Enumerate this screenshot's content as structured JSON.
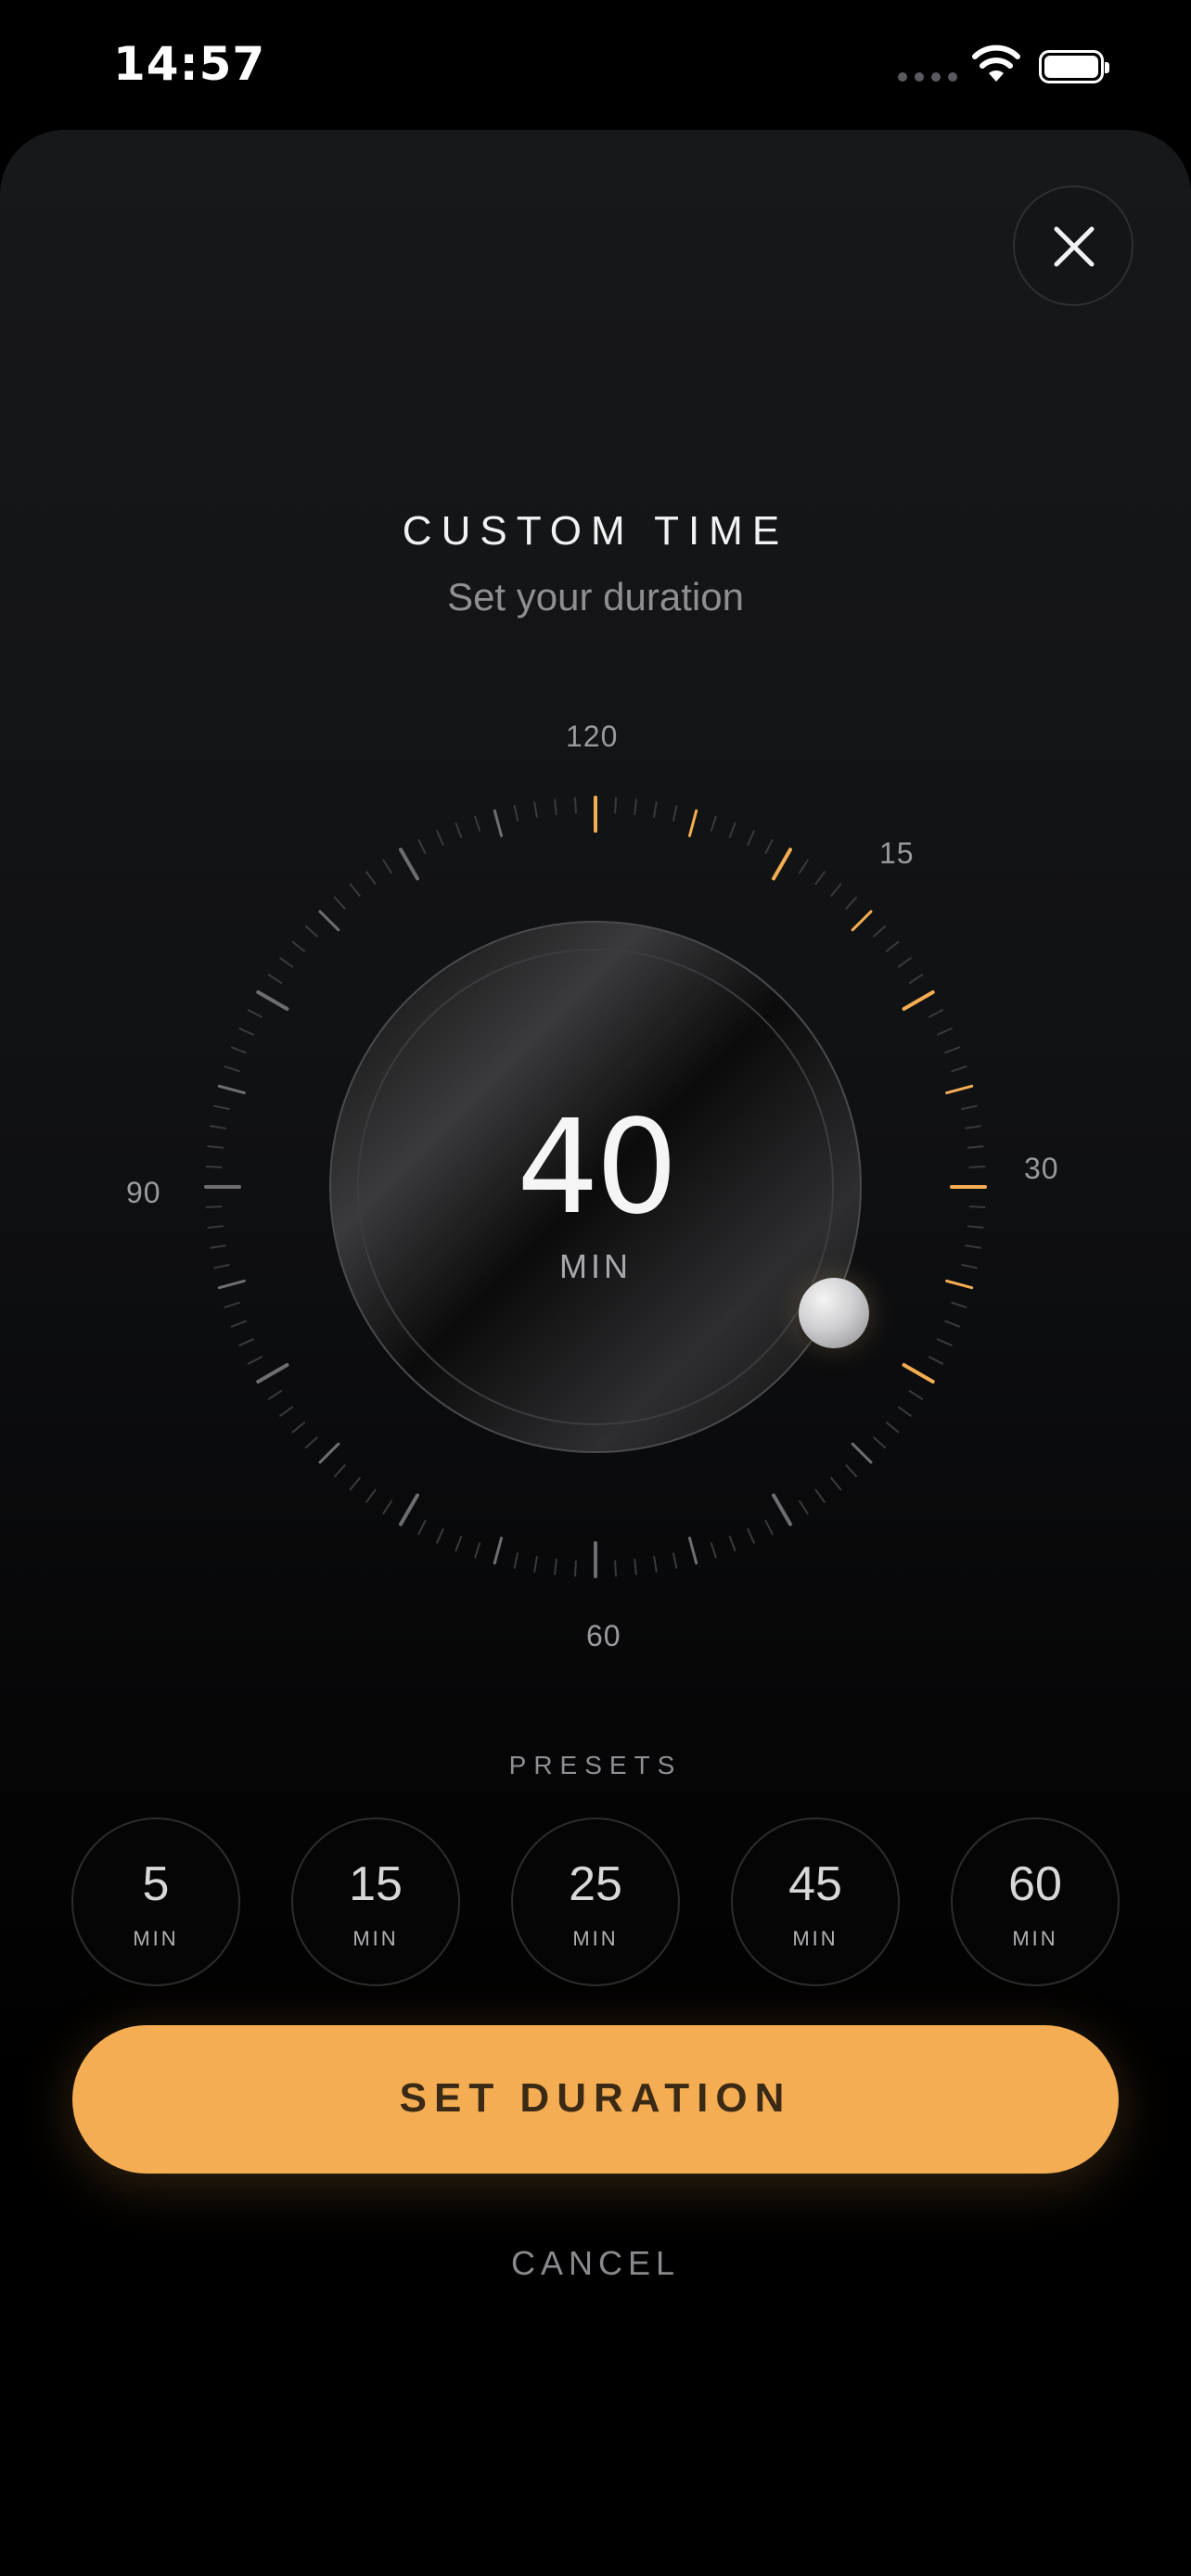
{
  "status_bar": {
    "time": "14:57"
  },
  "sheet": {
    "title": "CUSTOM TIME",
    "subtitle": "Set your duration"
  },
  "dial": {
    "labels": {
      "top": "120",
      "upper_right": "15",
      "right": "30",
      "bottom": "60",
      "left": "90"
    },
    "value": "40",
    "unit": "MIN",
    "selected_minutes": 40,
    "max_minutes": 120,
    "accent_color": "#f4ad52"
  },
  "presets": {
    "label": "PRESETS",
    "items": [
      {
        "value": "5",
        "unit": "MIN"
      },
      {
        "value": "15",
        "unit": "MIN"
      },
      {
        "value": "25",
        "unit": "MIN"
      },
      {
        "value": "45",
        "unit": "MIN"
      },
      {
        "value": "60",
        "unit": "MIN"
      }
    ]
  },
  "actions": {
    "primary": "SET DURATION",
    "secondary": "CANCEL"
  },
  "icons": {
    "close": "close-icon",
    "signal": "cellular-signal-icon",
    "wifi": "wifi-icon",
    "battery": "battery-icon"
  }
}
